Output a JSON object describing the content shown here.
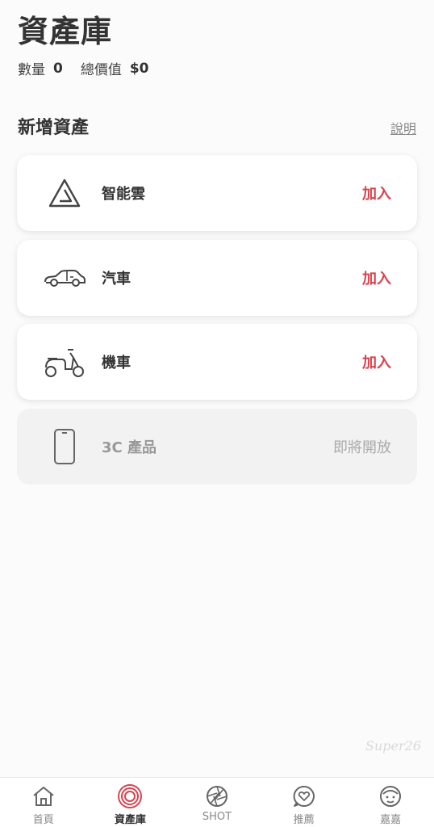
{
  "header": {
    "title": "資產庫",
    "quantity_label": "數量",
    "quantity_value": "0",
    "total_label": "總價值",
    "total_value": "$0"
  },
  "section": {
    "title": "新增資產",
    "help_label": "說明"
  },
  "assets": [
    {
      "name": "智能雲",
      "action": "加入",
      "icon": "smart-cloud-icon",
      "enabled": true
    },
    {
      "name": "汽車",
      "action": "加入",
      "icon": "car-icon",
      "enabled": true
    },
    {
      "name": "機車",
      "action": "加入",
      "icon": "scooter-icon",
      "enabled": true
    },
    {
      "name": "3C 產品",
      "action": "即將開放",
      "icon": "phone-icon",
      "enabled": false
    }
  ],
  "watermark": "Super26",
  "tabbar": {
    "items": [
      {
        "label": "首頁",
        "icon": "home-icon",
        "active": false
      },
      {
        "label": "資產庫",
        "icon": "asset-library-icon",
        "active": true
      },
      {
        "label": "SHOT",
        "icon": "shutter-icon",
        "active": false
      },
      {
        "label": "推薦",
        "icon": "heart-chat-icon",
        "active": false
      },
      {
        "label": "嘉嘉",
        "icon": "avatar-face-icon",
        "active": false
      }
    ]
  },
  "colors": {
    "accent": "#d9434e",
    "text": "#333333",
    "muted": "#888888",
    "background": "#fbfbfb"
  }
}
